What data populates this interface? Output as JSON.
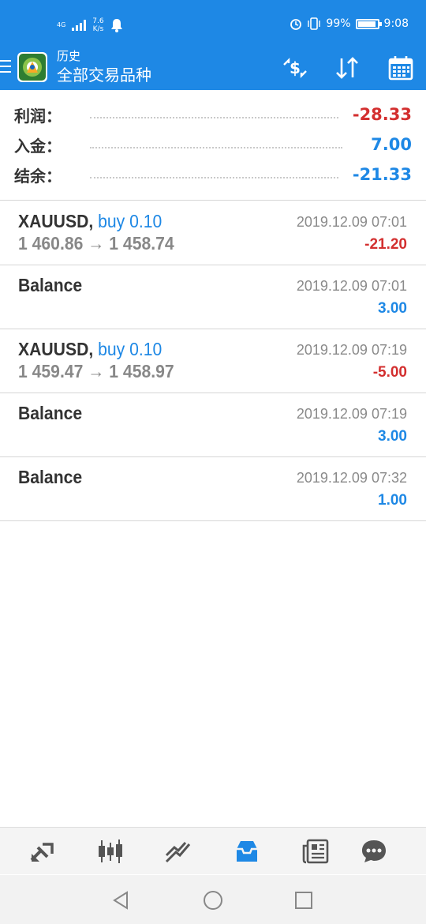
{
  "status_bar": {
    "network": "4G",
    "speed_value": "7.6",
    "speed_unit": "K/s",
    "battery": "99%",
    "time": "9:08"
  },
  "app_bar": {
    "title": "历史",
    "subtitle": "全部交易品种"
  },
  "summary": {
    "profit_label": "利润：",
    "profit_value": "-28.33",
    "deposit_label": "入金：",
    "deposit_value": "7.00",
    "balance_label": "结余：",
    "balance_value": "-21.33"
  },
  "history": [
    {
      "symbol": "XAUUSD,",
      "type": "buy 0.10",
      "prices": "1 460.86 → 1 458.74",
      "date": "2019.12.09 07:01",
      "amount": "-21.20"
    },
    {
      "symbol": "Balance",
      "type": "",
      "prices": "",
      "date": "2019.12.09 07:01",
      "amount": "3.00"
    },
    {
      "symbol": "XAUUSD,",
      "type": "buy 0.10",
      "prices": "1 459.47 → 1 458.97",
      "date": "2019.12.09 07:19",
      "amount": "-5.00"
    },
    {
      "symbol": "Balance",
      "type": "",
      "prices": "",
      "date": "2019.12.09 07:19",
      "amount": "3.00"
    },
    {
      "symbol": "Balance",
      "type": "",
      "prices": "",
      "date": "2019.12.09 07:32",
      "amount": "1.00"
    }
  ],
  "colors": {
    "accent": "#1e88e5",
    "negative": "#d32f2f",
    "positive": "#1e88e5"
  },
  "bottom_nav": {
    "active": "history-tab",
    "icons": [
      "quotes-icon",
      "chart-icon",
      "trade-icon",
      "history-icon",
      "news-icon",
      "chat-icon"
    ]
  }
}
